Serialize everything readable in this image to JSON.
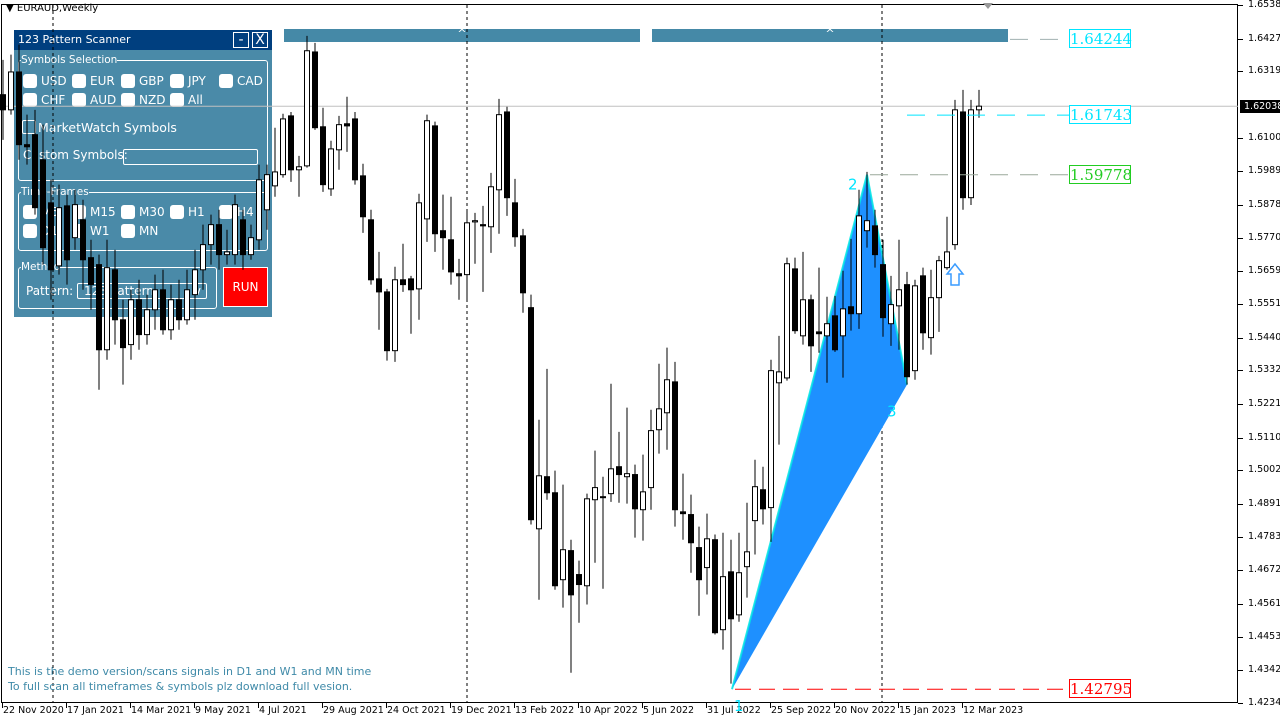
{
  "chart_title": "EURAUD,Weekly",
  "colors": {
    "panel_bg": "#4a8aa8",
    "title_bg": "#003f7f",
    "run_bg": "#ff0000",
    "pattern_fill": "#1e90ff",
    "pattern_edge": "#00e5e5",
    "level_cyan": "#00e5ff",
    "level_green": "#22cc22",
    "level_red": "#ff0000",
    "demo_text": "#3f8aa8"
  },
  "panel": {
    "title": "123 Pattern Scanner",
    "minimize_label": "-",
    "close_label": "X",
    "symbols_group": "Symbols Selection",
    "symbols": [
      "USD",
      "EUR",
      "GBP",
      "JPY",
      "CAD",
      "CHF",
      "AUD",
      "NZD",
      "All"
    ],
    "marketwatch_label": "MarketWatch Symbols",
    "custom_symbols_label": "Custom Symbols:",
    "custom_symbols_value": "",
    "timeframes_group": "Time-Frames",
    "timeframes": [
      "M5",
      "M15",
      "M30",
      "H1",
      "H4",
      "D1",
      "W1",
      "MN"
    ],
    "method_group": "Method",
    "pattern_label": "Pattern:",
    "pattern_value": "123 Pattern",
    "pattern_arrow": "v",
    "run_label": "RUN"
  },
  "top_buttons": [
    "^",
    "^"
  ],
  "demo_notice": [
    "This is the demo version/scans signals in D1 and W1 and MN time",
    "To full scan all timeframes & symbols plz download full vesion."
  ],
  "price_levels": [
    {
      "label": "1.64244",
      "value": 1.64244,
      "color": "#00e5ff"
    },
    {
      "label": "1.61743",
      "value": 1.61743,
      "color": "#00e5ff"
    },
    {
      "label": "1.59778",
      "value": 1.59778,
      "color": "#22cc22"
    },
    {
      "label": "1.42795",
      "value": 1.42795,
      "color": "#ff0000"
    }
  ],
  "current_price": "1.62038",
  "pattern_labels": [
    "1",
    "2",
    "3"
  ],
  "signal_icon": "up-arrow-icon",
  "chart_data": {
    "type": "candlestick",
    "symbol": "EURAUD",
    "timeframe": "Weekly",
    "ylim": [
      1.4234,
      1.6538
    ],
    "y_ticks": [
      "1.65380",
      "1.64270",
      "1.63190",
      "1.61000",
      "1.59890",
      "1.58780",
      "1.57700",
      "1.56590",
      "1.55510",
      "1.54400",
      "1.53320",
      "1.52210",
      "1.51100",
      "1.50020",
      "1.48910",
      "1.47830",
      "1.46720",
      "1.45610",
      "1.44530",
      "1.43420",
      "1.42340"
    ],
    "x_ticks": [
      "22 Nov 2020",
      "17 Jan 2021",
      "14 Mar 2021",
      "9 May 2021",
      "4 Jul 2021",
      "29 Aug 2021",
      "24 Oct 2021",
      "19 Dec 2021",
      "13 Feb 2022",
      "10 Apr 2022",
      "5 Jun 2022",
      "31 Jul 2022",
      "25 Sep 2022",
      "20 Nov 2022",
      "15 Jan 2023",
      "12 Mar 2023"
    ],
    "pattern_123": {
      "point1": 1.42795,
      "point2": 1.59778,
      "point3": 1.5285,
      "point1_candle": 91,
      "point2_candle": 108,
      "point3_candle": 113
    },
    "ohlc": [
      [
        1.6242,
        1.6357,
        1.6093,
        1.6192
      ],
      [
        1.6192,
        1.6374,
        1.6176,
        1.6317
      ],
      [
        1.6317,
        1.6407,
        1.6027,
        1.6077
      ],
      [
        1.6077,
        1.6176,
        1.6011,
        1.607
      ],
      [
        1.611,
        1.6192,
        1.5846,
        1.5869
      ],
      [
        1.6027,
        1.6143,
        1.5681,
        1.5737
      ],
      [
        1.5885,
        1.5961,
        1.5565,
        1.5664
      ],
      [
        1.5677,
        1.5945,
        1.5648,
        1.5869
      ],
      [
        1.5875,
        1.5912,
        1.5615,
        1.5697
      ],
      [
        1.577,
        1.5928,
        1.573,
        1.5879
      ],
      [
        1.5829,
        1.5895,
        1.5598,
        1.5697
      ],
      [
        1.5704,
        1.5763,
        1.5532,
        1.5615
      ],
      [
        1.5681,
        1.5714,
        1.5268,
        1.54
      ],
      [
        1.54,
        1.5763,
        1.5367,
        1.5671
      ],
      [
        1.5664,
        1.573,
        1.5417,
        1.5499
      ],
      [
        1.5499,
        1.5565,
        1.5285,
        1.5407
      ],
      [
        1.5417,
        1.5598,
        1.5367,
        1.5565
      ],
      [
        1.5565,
        1.5631,
        1.54,
        1.545
      ],
      [
        1.545,
        1.5582,
        1.5417,
        1.5532
      ],
      [
        1.5532,
        1.5648,
        1.5466,
        1.5598
      ],
      [
        1.5598,
        1.5664,
        1.545,
        1.5466
      ],
      [
        1.5466,
        1.5615,
        1.5433,
        1.5565
      ],
      [
        1.5565,
        1.5631,
        1.5466,
        1.5499
      ],
      [
        1.5499,
        1.5664,
        1.5483,
        1.5598
      ],
      [
        1.5582,
        1.573,
        1.5499,
        1.5664
      ],
      [
        1.5664,
        1.5813,
        1.5598,
        1.5747
      ],
      [
        1.5747,
        1.5846,
        1.5681,
        1.5813
      ],
      [
        1.5813,
        1.5862,
        1.5664,
        1.5714
      ],
      [
        1.5714,
        1.5796,
        1.5681,
        1.5723
      ],
      [
        1.5714,
        1.5912,
        1.5681,
        1.5879
      ],
      [
        1.5829,
        1.5862,
        1.5664,
        1.5714
      ],
      [
        1.5714,
        1.5813,
        1.5697,
        1.577
      ],
      [
        1.5763,
        1.6011,
        1.573,
        1.5961
      ],
      [
        1.5862,
        1.6011,
        1.5796,
        1.5978
      ],
      [
        1.5941,
        1.6133,
        1.5905,
        1.5987
      ],
      [
        1.5978,
        1.6179,
        1.5968,
        1.6162
      ],
      [
        1.6172,
        1.6185,
        1.5954,
        1.5994
      ],
      [
        1.5994,
        1.604,
        1.5905,
        1.6004
      ],
      [
        1.6007,
        1.6436,
        1.6001,
        1.6387
      ],
      [
        1.6383,
        1.6413,
        1.6126,
        1.6133
      ],
      [
        1.6136,
        1.6199,
        1.5921,
        1.5945
      ],
      [
        1.5931,
        1.609,
        1.5908,
        1.6063
      ],
      [
        1.606,
        1.6172,
        1.5994,
        1.6143
      ],
      [
        1.6146,
        1.6235,
        1.6053,
        1.6139
      ],
      [
        1.6162,
        1.6185,
        1.5945,
        1.5961
      ],
      [
        1.5974,
        1.6014,
        1.5786,
        1.5839
      ],
      [
        1.5829,
        1.5862,
        1.5615,
        1.5631
      ],
      [
        1.5634,
        1.5723,
        1.5466,
        1.5591
      ],
      [
        1.5591,
        1.5601,
        1.5364,
        1.5397
      ],
      [
        1.5397,
        1.5674,
        1.536,
        1.5631
      ],
      [
        1.5631,
        1.575,
        1.5591,
        1.5615
      ],
      [
        1.5634,
        1.5644,
        1.5453,
        1.5598
      ],
      [
        1.5601,
        1.5915,
        1.5499,
        1.5885
      ],
      [
        1.5832,
        1.6176,
        1.5756,
        1.6156
      ],
      [
        1.6139,
        1.6153,
        1.5723,
        1.5783
      ],
      [
        1.5793,
        1.5912,
        1.5664,
        1.577
      ],
      [
        1.5763,
        1.5905,
        1.5615,
        1.5657
      ],
      [
        1.5651,
        1.57,
        1.5565,
        1.5644
      ],
      [
        1.5648,
        1.5855,
        1.5565,
        1.5819
      ],
      [
        1.5822,
        1.5852,
        1.5684,
        1.5826
      ],
      [
        1.5813,
        1.5875,
        1.5591,
        1.5809
      ],
      [
        1.5806,
        1.5984,
        1.572,
        1.5938
      ],
      [
        1.5928,
        1.6228,
        1.5783,
        1.6176
      ],
      [
        1.6185,
        1.6202,
        1.5842,
        1.5902
      ],
      [
        1.5885,
        1.5964,
        1.574,
        1.5773
      ],
      [
        1.5776,
        1.5799,
        1.5522,
        1.5588
      ],
      [
        1.5539,
        1.5582,
        1.4823,
        1.4839
      ],
      [
        1.4809,
        1.5169,
        1.4575,
        1.4984
      ],
      [
        1.4981,
        1.5337,
        1.4905,
        1.4928
      ],
      [
        1.4928,
        1.5001,
        1.4608,
        1.4621
      ],
      [
        1.4641,
        1.4955,
        1.4549,
        1.474
      ],
      [
        1.4737,
        1.4773,
        1.4334,
        1.4591
      ],
      [
        1.4658,
        1.4704,
        1.4499,
        1.4625
      ],
      [
        1.4621,
        1.4925,
        1.4559,
        1.4908
      ],
      [
        1.4905,
        1.5067,
        1.4697,
        1.4945
      ],
      [
        1.4912,
        1.4981,
        1.4611,
        1.4915
      ],
      [
        1.4925,
        1.5288,
        1.4898,
        1.5007
      ],
      [
        1.5014,
        1.5129,
        1.4895,
        1.4988
      ],
      [
        1.4981,
        1.5209,
        1.4892,
        1.4991
      ],
      [
        1.4988,
        1.5021,
        1.478,
        1.4875
      ],
      [
        1.4872,
        1.5054,
        1.477,
        1.4931
      ],
      [
        1.4945,
        1.5202,
        1.4872,
        1.5133
      ],
      [
        1.5136,
        1.5354,
        1.5057,
        1.5205
      ],
      [
        1.5192,
        1.5407,
        1.507,
        1.5301
      ],
      [
        1.5294,
        1.536,
        1.4816,
        1.4872
      ],
      [
        1.4865,
        1.4991,
        1.4773,
        1.4859
      ],
      [
        1.4856,
        1.4922,
        1.4664,
        1.4763
      ],
      [
        1.4747,
        1.4816,
        1.4522,
        1.4641
      ],
      [
        1.4681,
        1.4859,
        1.4592,
        1.4776
      ],
      [
        1.4773,
        1.479,
        1.446,
        1.4466
      ],
      [
        1.4476,
        1.4796,
        1.441,
        1.4651
      ],
      [
        1.4667,
        1.4773,
        1.4298,
        1.4512
      ],
      [
        1.4525,
        1.4796,
        1.4502,
        1.4664
      ],
      [
        1.4684,
        1.4895,
        1.4582,
        1.4733
      ],
      [
        1.4836,
        1.5037,
        1.4724,
        1.4948
      ],
      [
        1.4938,
        1.5014,
        1.4823,
        1.4875
      ],
      [
        1.4879,
        1.5367,
        1.4766,
        1.5331
      ],
      [
        1.5291,
        1.5446,
        1.5087,
        1.5327
      ],
      [
        1.5307,
        1.5704,
        1.5298,
        1.5684
      ],
      [
        1.5667,
        1.5704,
        1.5453,
        1.5463
      ],
      [
        1.5446,
        1.5723,
        1.5417,
        1.5565
      ],
      [
        1.5565,
        1.5582,
        1.5327,
        1.5413
      ],
      [
        1.5459,
        1.5671,
        1.539,
        1.5453
      ],
      [
        1.5446,
        1.5575,
        1.5291,
        1.5486
      ],
      [
        1.5512,
        1.5578,
        1.5393,
        1.54
      ],
      [
        1.5446,
        1.5661,
        1.5308,
        1.5535
      ],
      [
        1.5542,
        1.5766,
        1.5463,
        1.5519
      ],
      [
        1.5519,
        1.5928,
        1.5469,
        1.5842
      ],
      [
        1.5793,
        1.5987,
        1.5737,
        1.5826
      ],
      [
        1.5809,
        1.5862,
        1.5671,
        1.5714
      ],
      [
        1.5681,
        1.5763,
        1.5443,
        1.5506
      ],
      [
        1.5486,
        1.5644,
        1.5413,
        1.5549
      ],
      [
        1.5545,
        1.5763,
        1.54,
        1.5598
      ],
      [
        1.5615,
        1.5657,
        1.5285,
        1.5311
      ],
      [
        1.5331,
        1.5631,
        1.5301,
        1.5611
      ],
      [
        1.5644,
        1.5671,
        1.54,
        1.5456
      ],
      [
        1.544,
        1.5664,
        1.5384,
        1.5572
      ],
      [
        1.5572,
        1.571,
        1.5459,
        1.5694
      ],
      [
        1.5671,
        1.5839,
        1.5664,
        1.5723
      ],
      [
        1.5747,
        1.6225,
        1.573,
        1.6192
      ],
      [
        1.6185,
        1.6258,
        1.5862,
        1.5902
      ],
      [
        1.5902,
        1.6225,
        1.5878,
        1.6192
      ],
      [
        1.6192,
        1.6258,
        1.6166,
        1.6204
      ]
    ]
  }
}
